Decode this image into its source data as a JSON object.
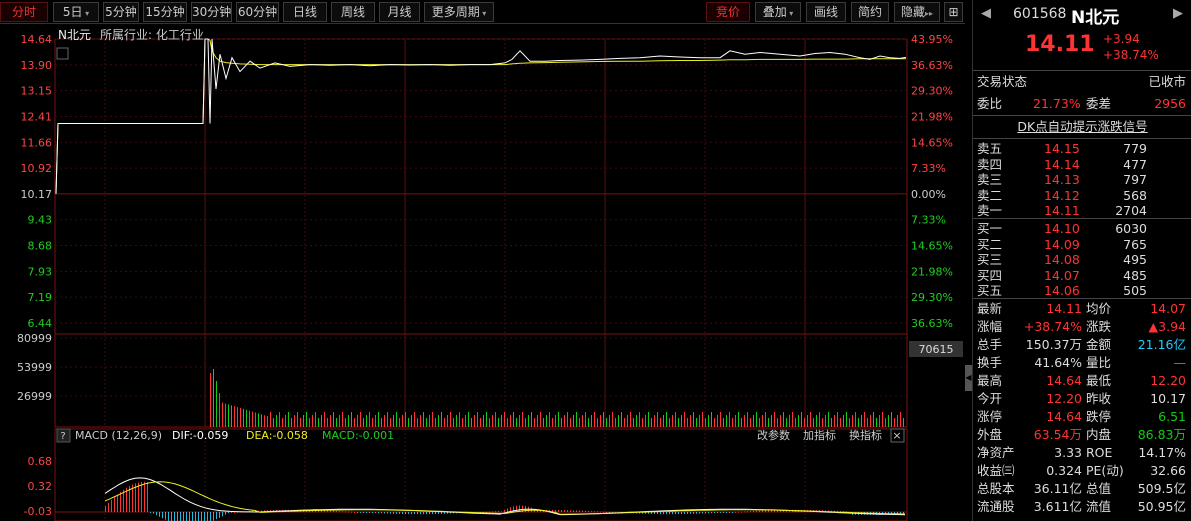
{
  "toolbar": {
    "left": [
      {
        "label": "分时",
        "active": true
      },
      {
        "label": "5日",
        "caret": true
      },
      {
        "label": "5分钟"
      },
      {
        "label": "15分钟"
      },
      {
        "label": "30分钟"
      },
      {
        "label": "60分钟"
      },
      {
        "label": "日线"
      },
      {
        "label": "周线"
      },
      {
        "label": "月线"
      },
      {
        "label": "更多周期",
        "caret": true
      }
    ],
    "right": [
      {
        "label": "竞价",
        "active": true
      },
      {
        "label": "叠加",
        "caret": true
      },
      {
        "label": "画线"
      },
      {
        "label": "简约"
      },
      {
        "label": "隐藏",
        "arrows": "▸▸"
      }
    ],
    "menu_icon": "grid-menu-icon"
  },
  "chart_header": {
    "name": "N北元",
    "industry": "所属行业: 化工行业"
  },
  "price_axis": {
    "left": [
      "14.64",
      "13.90",
      "13.15",
      "12.41",
      "11.66",
      "10.92",
      "10.17",
      "9.43",
      "8.68",
      "7.93",
      "7.19",
      "6.44"
    ],
    "right": [
      "43.95%",
      "36.63%",
      "29.30%",
      "21.98%",
      "14.65%",
      "7.33%",
      "0.00%",
      "7.33%",
      "14.65%",
      "21.98%",
      "29.30%",
      "36.63%"
    ]
  },
  "volume_axis": {
    "left": [
      "80999",
      "53999",
      "26999"
    ],
    "current_volume": "70615"
  },
  "macd": {
    "help": "?",
    "title": "MACD (12,26,9)",
    "dif": "DIF:-0.059",
    "dea": "DEA:-0.058",
    "macd": "MACD:-0.001",
    "axis": [
      "0.68",
      "0.32",
      "-0.03",
      "-0.39"
    ],
    "actions": [
      "改参数",
      "加指标",
      "换指标"
    ],
    "close": "×"
  },
  "chart_data": {
    "type": "line",
    "price_range": [
      6.44,
      14.64
    ],
    "prev_close": 10.17,
    "price": [
      10.17,
      12.2,
      12.2,
      12.2,
      12.2,
      14.64,
      14.64,
      14.64,
      14.64,
      12.2,
      14.64,
      13.2,
      14.2,
      13.5,
      14.1,
      13.7,
      14.0,
      13.8,
      13.95,
      13.85,
      13.9,
      13.88,
      13.9,
      13.87,
      13.9,
      13.89,
      13.9,
      13.88,
      13.9,
      13.9,
      13.95,
      14.05,
      14.3,
      14.0,
      14.0,
      14.02,
      14.03,
      14.05,
      14.08,
      14.1,
      14.15,
      14.12,
      14.1,
      14.1,
      14.3,
      14.2,
      14.25,
      14.2,
      14.15,
      14.22,
      14.25,
      14.2,
      14.1,
      14.05,
      14.15,
      14.1,
      14.08,
      14.11
    ],
    "avg": [
      10.17,
      12.2,
      12.2,
      12.2,
      12.2,
      14.64,
      14.64,
      14.64,
      14.64,
      14.6,
      14.3,
      14.1,
      14.0,
      13.96,
      13.94,
      13.92,
      13.91,
      13.9,
      13.9,
      13.9,
      13.9,
      13.9,
      13.9,
      13.9,
      13.9,
      13.9,
      13.9,
      13.9,
      13.9,
      13.9,
      13.9,
      13.92,
      13.94,
      13.95,
      13.96,
      13.97,
      13.98,
      13.99,
      14.0,
      14.0,
      14.01,
      14.02,
      14.02,
      14.03,
      14.04,
      14.04,
      14.05,
      14.05,
      14.05,
      14.06,
      14.06,
      14.06,
      14.07,
      14.07,
      14.07,
      14.07,
      14.07,
      14.07
    ],
    "volume_max": 80999,
    "macd_range": [
      -0.39,
      0.68
    ]
  },
  "panel": {
    "code": "601568",
    "name": "N北元",
    "price": "14.11",
    "change": "+3.94",
    "change_pct": "+38.74%",
    "trade_status_label": "交易状态",
    "trade_status": "已收市",
    "webi_label": "委比",
    "webi": "21.73%",
    "weicha_label": "委差",
    "weicha": "2956",
    "signal": "DK点自动提示涨跌信号",
    "asks": [
      {
        "label": "卖五",
        "price": "14.15",
        "vol": "779"
      },
      {
        "label": "卖四",
        "price": "14.14",
        "vol": "477"
      },
      {
        "label": "卖三",
        "price": "14.13",
        "vol": "797"
      },
      {
        "label": "卖二",
        "price": "14.12",
        "vol": "568"
      },
      {
        "label": "卖一",
        "price": "14.11",
        "vol": "2704"
      }
    ],
    "bids": [
      {
        "label": "买一",
        "price": "14.10",
        "vol": "6030"
      },
      {
        "label": "买二",
        "price": "14.09",
        "vol": "765"
      },
      {
        "label": "买三",
        "price": "14.08",
        "vol": "495"
      },
      {
        "label": "买四",
        "price": "14.07",
        "vol": "485"
      },
      {
        "label": "买五",
        "price": "14.06",
        "vol": "505"
      }
    ],
    "stats": [
      {
        "l1": "最新",
        "v1": "14.11",
        "c1": "r",
        "l2": "均价",
        "v2": "14.07",
        "c2": "r"
      },
      {
        "l1": "涨幅",
        "v1": "+38.74%",
        "c1": "r",
        "l2": "涨跌",
        "v2": "▲3.94",
        "c2": "r"
      },
      {
        "l1": "总手",
        "v1": "150.37万",
        "c1": "w",
        "l2": "金额",
        "v2": "21.16亿",
        "c2": "c"
      },
      {
        "l1": "换手",
        "v1": "41.64%",
        "c1": "w",
        "l2": "量比",
        "v2": "—",
        "c2": "g"
      },
      {
        "l1": "最高",
        "v1": "14.64",
        "c1": "r",
        "l2": "最低",
        "v2": "12.20",
        "c2": "r"
      },
      {
        "l1": "今开",
        "v1": "12.20",
        "c1": "r",
        "l2": "昨收",
        "v2": "10.17",
        "c2": "w"
      },
      {
        "l1": "涨停",
        "v1": "14.64",
        "c1": "r",
        "l2": "跌停",
        "v2": "6.51",
        "c2": "g"
      },
      {
        "l1": "外盘",
        "v1": "63.54万",
        "c1": "r",
        "l2": "内盘",
        "v2": "86.83万",
        "c2": "g"
      },
      {
        "l1": "净资产",
        "v1": "3.33",
        "c1": "w",
        "l2": "ROE",
        "v2": "14.17%",
        "c2": "w"
      },
      {
        "l1": "收益㈢",
        "v1": "0.324",
        "c1": "w",
        "l2": "PE(动)",
        "v2": "32.66",
        "c2": "w"
      },
      {
        "l1": "总股本",
        "v1": "36.11亿",
        "c1": "w",
        "l2": "总值",
        "v2": "509.5亿",
        "c2": "w"
      },
      {
        "l1": "流通股",
        "v1": "3.611亿",
        "c1": "w",
        "l2": "流值",
        "v2": "50.95亿",
        "c2": "w"
      }
    ],
    "colors": {
      "up": "#ff3333",
      "down": "#11cc11",
      "price_line": "#ffffff",
      "avg_line": "#eeee22"
    }
  }
}
